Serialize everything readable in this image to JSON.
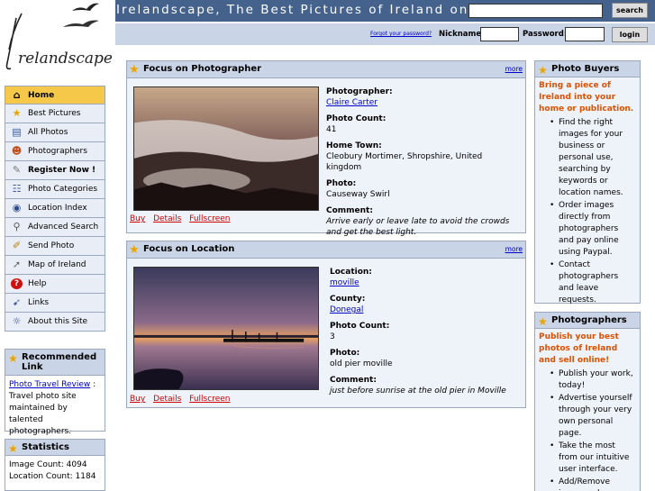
{
  "header": {
    "site_title": "Irelandscape, The Best Pictures of Ireland on the Internet",
    "search_button": "search",
    "search_value": "",
    "forgot_password": "Forgot your password?",
    "nickname_label": "Nickname:",
    "password_label": "Password:",
    "login_button": "login",
    "logo_icon": "irelandscape-logo"
  },
  "nav": {
    "items": [
      {
        "label": "Home",
        "icon": "home-icon",
        "glyph": "⌂"
      },
      {
        "label": "Best Pictures",
        "icon": "star-icon",
        "glyph": "★"
      },
      {
        "label": "All Photos",
        "icon": "photos-icon",
        "glyph": "▤"
      },
      {
        "label": "Photographers",
        "icon": "photographers-icon",
        "glyph": "☻"
      },
      {
        "label": "Register Now !",
        "icon": "register-icon",
        "glyph": "✎"
      },
      {
        "label": "Photo Categories",
        "icon": "categories-icon",
        "glyph": "☷"
      },
      {
        "label": "Location Index",
        "icon": "globe-icon",
        "glyph": "◉"
      },
      {
        "label": "Advanced Search",
        "icon": "magnifier-icon",
        "glyph": "⚲"
      },
      {
        "label": "Send Photo",
        "icon": "pen-icon",
        "glyph": "✐"
      },
      {
        "label": "Map of Ireland",
        "icon": "cursor-icon",
        "glyph": "➚"
      },
      {
        "label": "Help",
        "icon": "help-icon",
        "glyph": "?"
      },
      {
        "label": "Links",
        "icon": "link-icon",
        "glyph": "➹"
      },
      {
        "label": "About this Site",
        "icon": "info-icon",
        "glyph": "☼"
      }
    ]
  },
  "recommended": {
    "title": "Recommended Link",
    "link_text": "Photo Travel Review",
    "description": " : Travel photo site maintained by talented photographers."
  },
  "statistics": {
    "title": "Statistics",
    "image_count": "Image Count: 4094",
    "location_count": "Location Count: 1184"
  },
  "focus_photographer": {
    "title": "Focus on Photographer",
    "more": "more",
    "photographer_label": "Photographer:",
    "photographer": "Claire Carter",
    "photo_count_label": "Photo Count:",
    "photo_count": "41",
    "home_town_label": "Home Town:",
    "home_town": "Cleobury Mortimer, Shropshire, United kingdom",
    "photo_label": "Photo:",
    "photo": "Causeway Swirl",
    "comment_label": "Comment:",
    "comment": "Arrive early or leave late to avoid the crowds and get the best light.",
    "actions": [
      "Buy",
      "Details",
      "Fullscreen"
    ]
  },
  "focus_location": {
    "title": "Focus on Location",
    "more": "more",
    "location_label": "Location:",
    "location": "moville",
    "county_label": "County:",
    "county": "Donegal",
    "photo_count_label": "Photo Count:",
    "photo_count": "3",
    "photo_label": "Photo:",
    "photo": "old pier moville",
    "comment_label": "Comment:",
    "comment": "just before sunrise at the old pier in Moville",
    "actions": [
      "Buy",
      "Details",
      "Fullscreen"
    ]
  },
  "photo_buyers": {
    "title": "Photo Buyers",
    "intro": "Bring a piece of Ireland into your home or publication.",
    "items": [
      "Find the right images for your business or personal use, searching by keywords or location names.",
      "Order images directly from photographers and pay online using Paypal.",
      "Contact photographers and leave requests."
    ]
  },
  "photographers_box": {
    "title": "Photographers",
    "intro": "Publish your best photos of Ireland and sell online!",
    "items": [
      "Publish your work, today!",
      "Advertise yourself through your very own personal page.",
      "Take the most from our intuitive user interface.",
      "Add/Remove images whenever"
    ]
  },
  "colors": {
    "header_blue": "#44628c",
    "panel_head": "#c9d4e6",
    "home_highlight": "#f5c84a",
    "intro_orange": "#e05000"
  }
}
